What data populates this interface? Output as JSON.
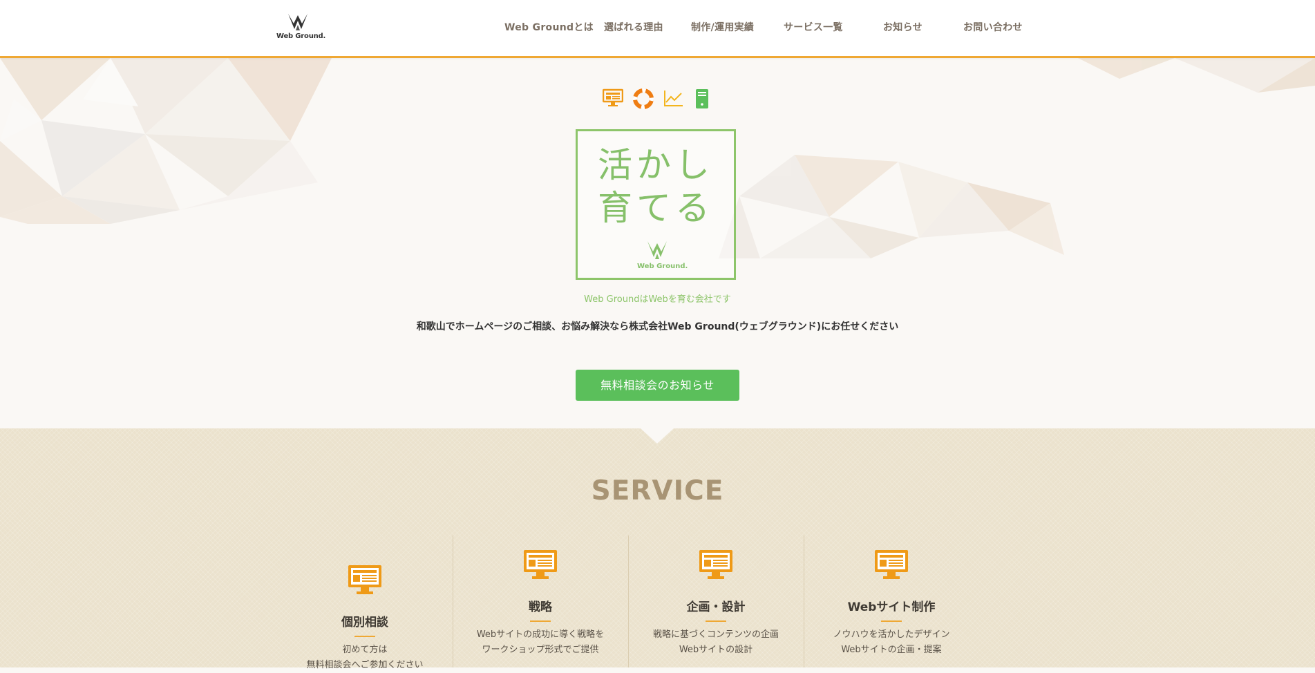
{
  "header": {
    "logo_text": "Web Ground.",
    "nav": [
      {
        "label": "Web Groundとは"
      },
      {
        "label": "選ばれる理由"
      },
      {
        "label": "制作/運用実績"
      },
      {
        "label": "サービス一覧"
      },
      {
        "label": "お知らせ"
      },
      {
        "label": "お問い合わせ"
      }
    ]
  },
  "hero": {
    "tagline_line1": "活かし",
    "tagline_line2": "育てる",
    "box_logo_text": "Web Ground.",
    "subtitle": "Web GroundはWebを育む会社です",
    "description": "和歌山でホームページのご相談、お悩み解決なら株式会社Web Ground(ウェブグラウンド)にお任せください",
    "cta_label": "無料相談会のお知らせ"
  },
  "service": {
    "title": "SERVICE",
    "items": [
      {
        "title": "個別相談",
        "lines": [
          "初めて方は",
          "無料相談会へご参加ください"
        ]
      },
      {
        "title": "戦略",
        "lines": [
          "Webサイトの成功に導く戦略を",
          "ワークショップ形式でご提供"
        ]
      },
      {
        "title": "企画・設計",
        "lines": [
          "戦略に基づくコンテンツの企画",
          "Webサイトの設計"
        ]
      },
      {
        "title": "Webサイト制作",
        "lines": [
          "ノウハウを活かしたデザイン",
          "Webサイトの企画・提案"
        ]
      }
    ]
  },
  "colors": {
    "accent_orange": "#efa834",
    "green": "#5bbf5b",
    "tagline_green": "#86c06a",
    "service_bg": "#ebe2cd",
    "service_title": "#a89474"
  },
  "icons": [
    "monitor-icon",
    "lifebuoy-icon",
    "chart-line-icon",
    "server-icon"
  ]
}
